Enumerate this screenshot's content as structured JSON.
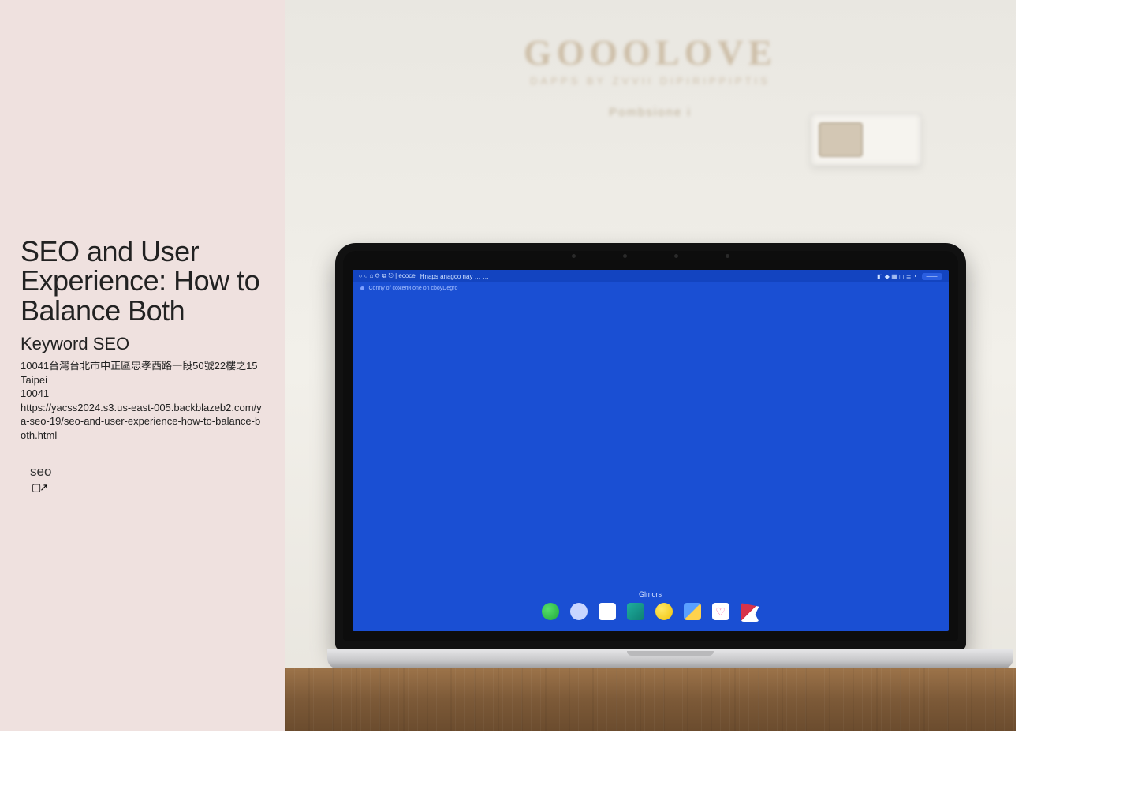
{
  "sidebar": {
    "title": "SEO and User Experience: How to Balance Both",
    "subtitle": "Keyword SEO",
    "address_line": "10041台灣台北市中正區忠孝西路一段50號22樓之15",
    "city": "Taipei",
    "postal": "10041",
    "url": "https://yacss2024.s3.us-east-005.backblazeb2.com/ya-seo-19/seo-and-user-experience-how-to-balance-both.html",
    "tag": "seo"
  },
  "hero": {
    "wall_logo_big": "GOOOLOVE",
    "wall_logo_sub": "DAPPS BY ZVVII DIPIRIPPIPTIS",
    "wall_logo_sub2": "Pombsione i",
    "menubar_left": "○ ○ ⌂ ⟳ ⧉ ⎋ | ecoce",
    "menubar_center": "Hnaps anagco nay … …",
    "menubar_right_icons": "◧ ◆ ▦ ◻ ≣ ◔",
    "menubar_right_pill": "——",
    "toolbar_text": "Сonny of сожели оnе оn сboyDegro",
    "dock_label": "Glmors"
  }
}
